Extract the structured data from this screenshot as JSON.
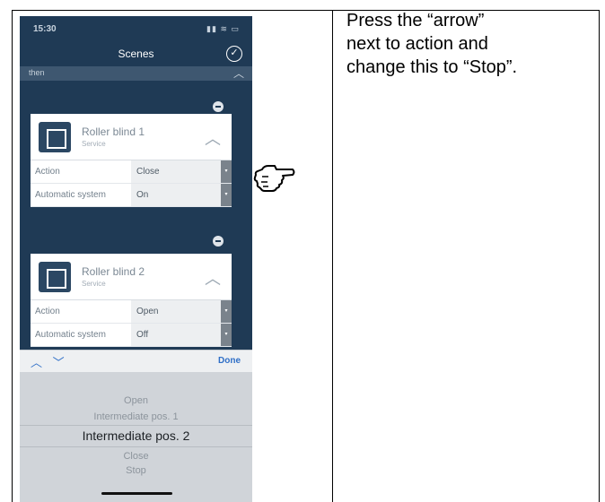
{
  "status_bar": {
    "time": "15:30",
    "indicators": "▮▮ ≋ ▭"
  },
  "navbar": {
    "title": "Scenes",
    "confirm_glyph": "✓"
  },
  "section": {
    "label": "then",
    "chevron_glyph": "︿"
  },
  "cards": [
    {
      "name": "Roller blind 1",
      "subtitle": "Service",
      "collapse_glyph": "︿",
      "rows": [
        {
          "label": "Action",
          "value": "Close"
        },
        {
          "label": "Automatic system",
          "value": "On"
        }
      ]
    },
    {
      "name": "Roller blind 2",
      "subtitle": "Service",
      "collapse_glyph": "︿",
      "rows": [
        {
          "label": "Action",
          "value": "Open"
        },
        {
          "label": "Automatic system",
          "value": "Off"
        }
      ]
    }
  ],
  "toolbar": {
    "nav_glyphs": "︿ ﹀",
    "done_label": "Done"
  },
  "picker": {
    "options": [
      "Open",
      "Intermediate pos. 1",
      "Intermediate pos. 2",
      "Close",
      "Stop"
    ],
    "selected": "Intermediate pos. 2"
  },
  "icons": {
    "dropdown_arrow": "▾",
    "hand_pointer": "hand-pointer-icon",
    "device": "roller-blind-icon",
    "remove": "minus-circle-icon"
  },
  "instruction": {
    "line1": "Press the “arrow”",
    "line2": "next to action and",
    "line3": "change this to “Stop”."
  },
  "colors": {
    "app_background": "#1f3a55",
    "accent": "#2f6fc7",
    "card": "#ffffff",
    "picker": "#d0d4d9"
  }
}
